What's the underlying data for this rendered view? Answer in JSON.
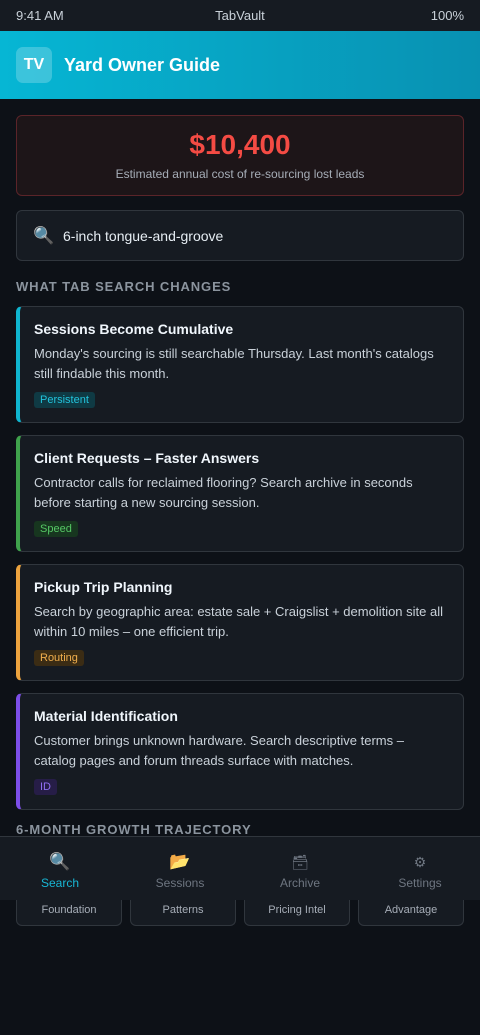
{
  "status": {
    "time": "9:41 AM",
    "carrier": "TabVault",
    "battery": "100%"
  },
  "header": {
    "logo": "TV",
    "title": "Yard Owner Guide"
  },
  "cost": {
    "value": "$10,400",
    "caption": "Estimated annual cost of re-sourcing lost leads"
  },
  "search": {
    "icon": "search-icon",
    "query": "6-inch tongue-and-groove"
  },
  "section_changes": {
    "heading": "WHAT TAB SEARCH CHANGES"
  },
  "features": [
    {
      "title": "Sessions Become Cumulative",
      "description": "Monday's sourcing is still searchable Thursday. Last month's catalogs still findable this month.",
      "tag": "Persistent",
      "accent": "#0fb5cf",
      "tag_bg": "#0f3a44",
      "tag_color": "#22c3dc"
    },
    {
      "title": "Client Requests – Faster Answers",
      "description": "Contractor calls for reclaimed flooring? Search archive in seconds before starting a new sourcing session.",
      "tag": "Speed",
      "accent": "#3fa24c",
      "tag_bg": "#17361f",
      "tag_color": "#56c865"
    },
    {
      "title": "Pickup Trip Planning",
      "description": "Search by geographic area: estate sale + Craigslist + demolition site all within 10 miles – one efficient trip.",
      "tag": "Routing",
      "accent": "#eca33e",
      "tag_bg": "#3b2c14",
      "tag_color": "#f0ae4d"
    },
    {
      "title": "Material Identification",
      "description": "Customer brings unknown hardware. Search descriptive terms – catalog pages and forum threads surface with matches.",
      "tag": "ID",
      "accent": "#7c4ee8",
      "tag_bg": "#261d47",
      "tag_color": "#8f6df0"
    }
  ],
  "section_growth": {
    "heading": "6-MONTH GROWTH TRAJECTORY"
  },
  "growth_cards": [
    {
      "label": "Foundation"
    },
    {
      "label": "Patterns"
    },
    {
      "label": "Pricing Intel"
    },
    {
      "label": "Advantage"
    }
  ],
  "nav": [
    {
      "label": "Search",
      "icon": "search-icon",
      "glyph": "🔍",
      "active": true
    },
    {
      "label": "Sessions",
      "icon": "folder-icon",
      "glyph": "📂",
      "active": false
    },
    {
      "label": "Archive",
      "icon": "archive-icon",
      "glyph": "🗃",
      "active": false
    },
    {
      "label": "Settings",
      "icon": "gear-icon",
      "glyph": "⚙",
      "active": false
    }
  ]
}
